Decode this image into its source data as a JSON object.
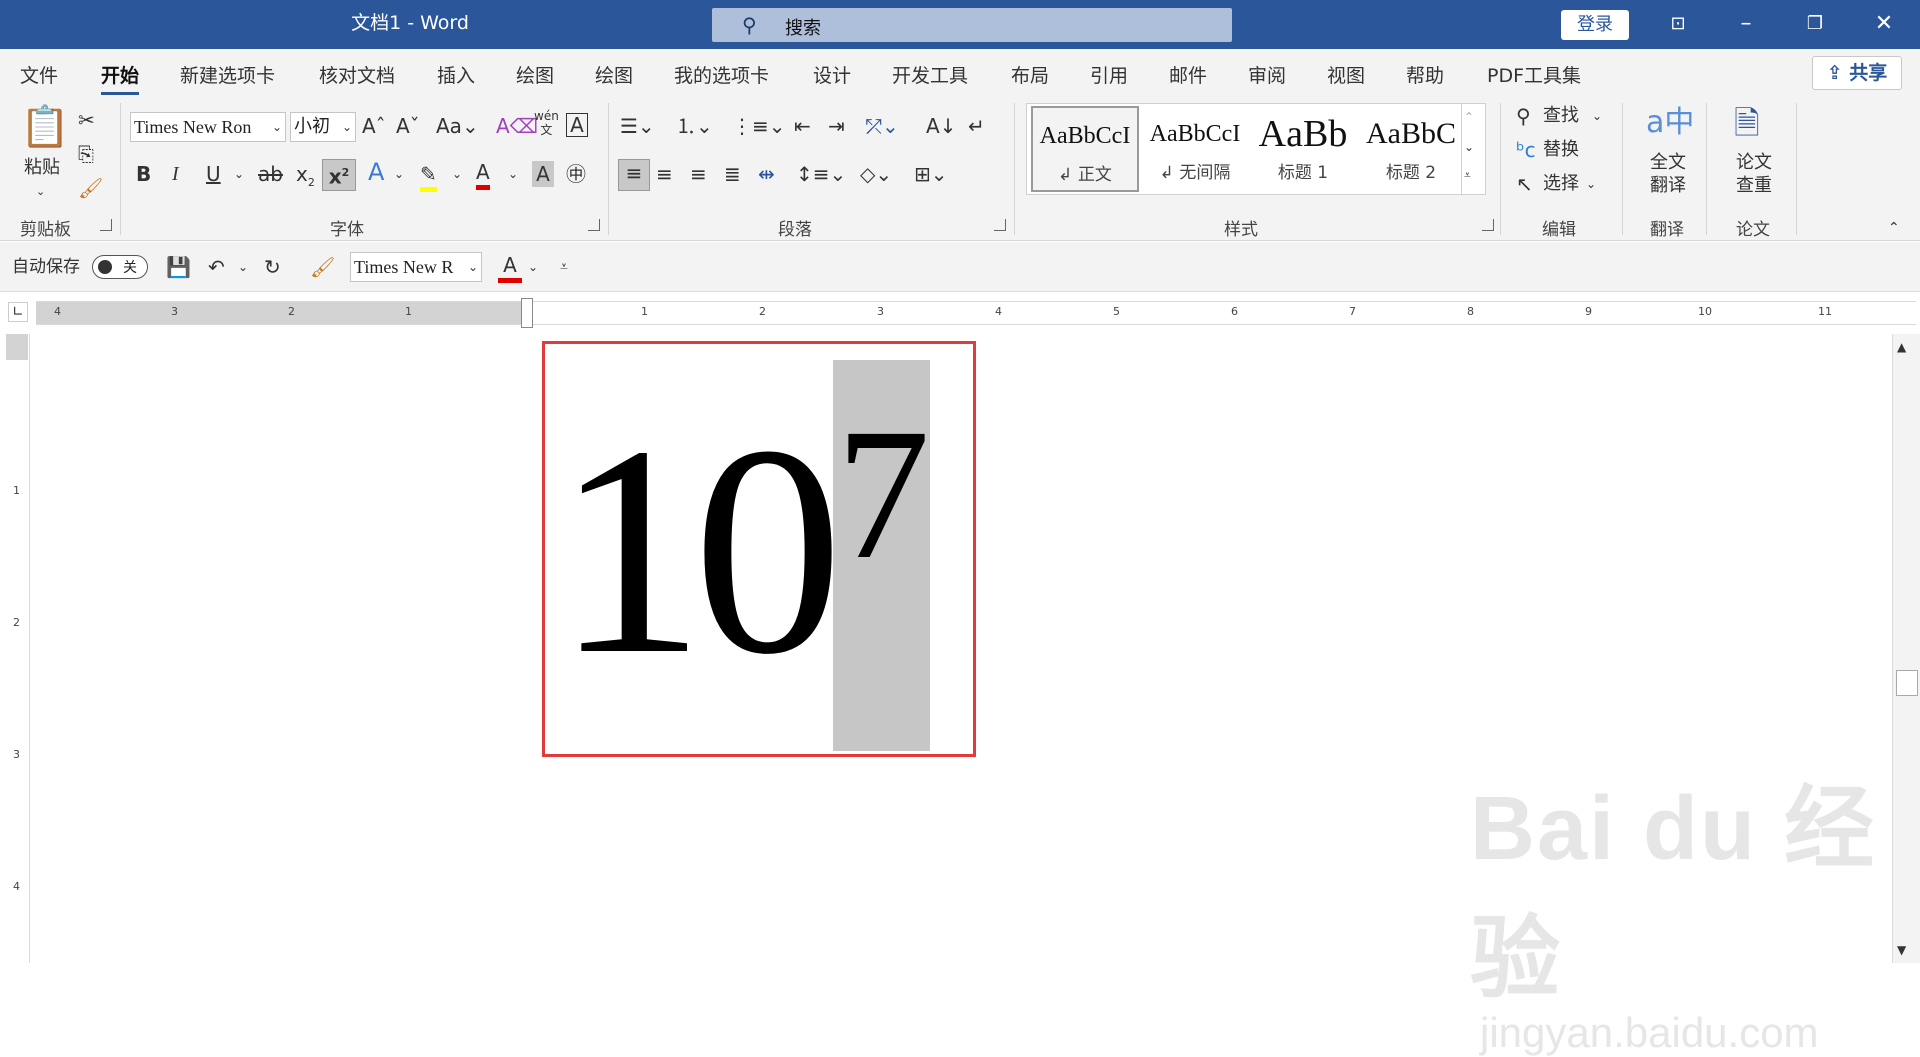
{
  "window": {
    "title": "文档1  -  Word",
    "search_placeholder": "搜索",
    "login": "登录"
  },
  "menu": {
    "tabs": [
      "文件",
      "开始",
      "新建选项卡",
      "核对文档",
      "插入",
      "绘图",
      "绘图",
      "我的选项卡",
      "设计",
      "开发工具",
      "布局",
      "引用",
      "邮件",
      "审阅",
      "视图",
      "帮助",
      "PDF工具集"
    ],
    "share": "共享"
  },
  "ribbon": {
    "clipboard": {
      "paste": "粘贴",
      "label": "剪贴板"
    },
    "font": {
      "name": "Times New Ron",
      "size": "小初",
      "label": "字体"
    },
    "paragraph": {
      "label": "段落"
    },
    "styles": {
      "label": "样式",
      "items": [
        {
          "preview": "AaBbCcI",
          "name": "↲ 正文"
        },
        {
          "preview": "AaBbCcI",
          "name": "↲ 无间隔"
        },
        {
          "preview": "AaBb",
          "name": "标题 1"
        },
        {
          "preview": "AaBbC",
          "name": "标题 2"
        }
      ]
    },
    "editing": {
      "find": "查找",
      "replace": "替换",
      "select": "选择",
      "label": "编辑"
    },
    "translate": {
      "btn": "全文翻译",
      "label": "翻译"
    },
    "paper": {
      "btn": "论文查重",
      "label": "论文"
    }
  },
  "qat": {
    "autosave": "自动保存",
    "toggle": "关",
    "font": "Times New R",
    "font_color": "A"
  },
  "ruler": {
    "h_numbers": [
      "4",
      "3",
      "2",
      "1",
      "1",
      "2",
      "3",
      "4",
      "5",
      "6",
      "7",
      "8",
      "9",
      "10",
      "11"
    ],
    "v_numbers": [
      "1",
      "2",
      "3",
      "4"
    ]
  },
  "document": {
    "base": "10",
    "superscript": "7"
  },
  "watermark": {
    "main": "Bai du 经验",
    "sub": "jingyan.baidu.com"
  },
  "colors": {
    "accent": "#2b579a",
    "highlight_frame": "#e33a3a",
    "selection": "#c6c6c6"
  }
}
